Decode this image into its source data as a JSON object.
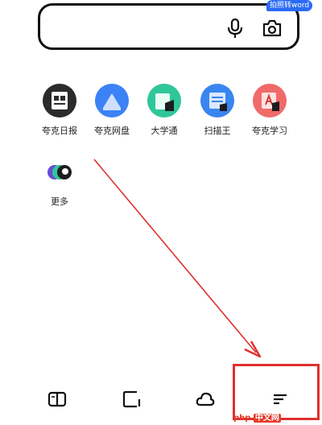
{
  "search": {
    "badge": "拍照转word"
  },
  "apps": [
    {
      "label": "夸克日报",
      "icon": "daily-news-icon",
      "color": "#2b2b2b"
    },
    {
      "label": "夸克网盘",
      "icon": "cloud-drive-icon",
      "color": "#3b82f6"
    },
    {
      "label": "大学通",
      "icon": "university-icon",
      "color": "#2fc79a"
    },
    {
      "label": "扫描王",
      "icon": "scanner-icon",
      "color": "#3a86f0"
    },
    {
      "label": "夸克学习",
      "icon": "study-icon",
      "color": "#f06a6a"
    },
    {
      "label": "更多",
      "icon": "more-icon",
      "color": "#ffffff"
    }
  ],
  "bottom_nav": [
    {
      "icon": "book-icon"
    },
    {
      "icon": "tabs-icon"
    },
    {
      "icon": "cloud-icon"
    },
    {
      "icon": "menu-icon"
    }
  ],
  "watermark": {
    "prefix": "php",
    "suffix": "中文网"
  },
  "colors": {
    "annotation": "#e0302e",
    "badge": "#2a6af5"
  }
}
